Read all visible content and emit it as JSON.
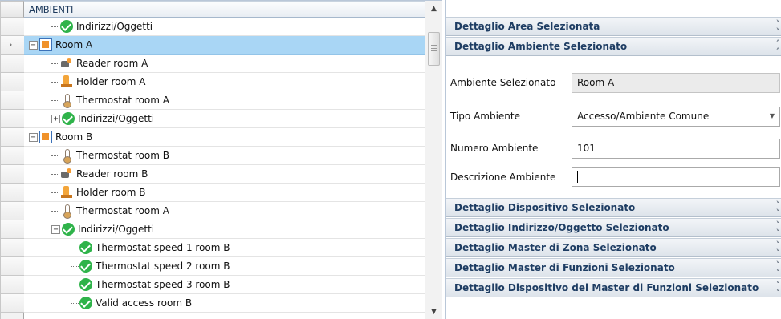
{
  "tree": {
    "column_header": "AMBIENTI",
    "rows": [
      {
        "label": "Indirizzi/Oggetti",
        "icon": "check-icon",
        "indent": 1,
        "expander": ""
      },
      {
        "label": "Room A",
        "icon": "room-icon",
        "indent": 0,
        "expander": "⊟",
        "selected": true
      },
      {
        "label": "Reader room A",
        "icon": "reader-icon",
        "indent": 1,
        "expander": ""
      },
      {
        "label": "Holder room A",
        "icon": "holder-icon",
        "indent": 1,
        "expander": ""
      },
      {
        "label": "Thermostat room A",
        "icon": "thermostat-icon",
        "indent": 1,
        "expander": ""
      },
      {
        "label": "Indirizzi/Oggetti",
        "icon": "check-icon",
        "indent": 1,
        "expander": "⊞"
      },
      {
        "label": "Room B",
        "icon": "room-icon",
        "indent": 0,
        "expander": "⊟"
      },
      {
        "label": "Thermostat room B",
        "icon": "thermostat-icon",
        "indent": 1,
        "expander": ""
      },
      {
        "label": "Reader room B",
        "icon": "reader-icon",
        "indent": 1,
        "expander": ""
      },
      {
        "label": "Holder room B",
        "icon": "holder-icon",
        "indent": 1,
        "expander": ""
      },
      {
        "label": "Thermostat room A",
        "icon": "thermostat-icon",
        "indent": 1,
        "expander": ""
      },
      {
        "label": "Indirizzi/Oggetti",
        "icon": "check-icon",
        "indent": 1,
        "expander": "⊟"
      },
      {
        "label": "Thermostat speed 1 room B",
        "icon": "check-icon",
        "indent": 2,
        "expander": ""
      },
      {
        "label": "Thermostat speed 2 room B",
        "icon": "check-icon",
        "indent": 2,
        "expander": ""
      },
      {
        "label": "Thermostat speed 3 room B",
        "icon": "check-icon",
        "indent": 2,
        "expander": ""
      },
      {
        "label": "Valid access room B",
        "icon": "check-icon",
        "indent": 2,
        "expander": ""
      }
    ]
  },
  "detail": {
    "area_header": "Dettaglio Area Selezionata",
    "ambiente_header": "Dettaglio Ambiente Selezionato",
    "fields": {
      "ambiente_selezionato_label": "Ambiente Selezionato",
      "ambiente_selezionato_value": "Room A",
      "tipo_ambiente_label": "Tipo Ambiente",
      "tipo_ambiente_value": "Accesso/Ambiente Comune",
      "numero_ambiente_label": "Numero Ambiente",
      "numero_ambiente_value": "101",
      "descrizione_ambiente_label": "Descrizione Ambiente",
      "descrizione_ambiente_value": ""
    },
    "collapsed_sections": [
      "Dettaglio Dispositivo Selezionato",
      "Dettaglio Indirizzo/Oggetto Selezionato",
      "Dettaglio Master di Zona Selezionato",
      "Dettaglio Master di Funzioni Selezionato",
      "Dettaglio Dispositivo del Master di Funzioni Selezionato"
    ]
  },
  "colors": {
    "selection": "#a9d6f5",
    "group_title": "#1e3d63",
    "check_green": "#2fb34a",
    "room_orange": "#f0922a"
  }
}
